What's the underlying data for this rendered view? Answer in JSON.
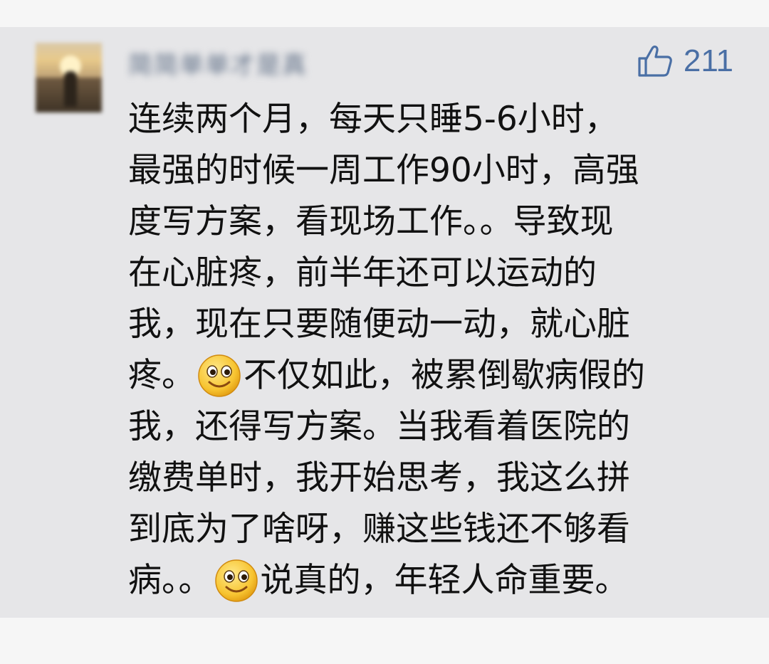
{
  "comment": {
    "username": "简简单单才是真",
    "like_count": "211",
    "lines": [
      {
        "before": "连续两个月，每天只睡5-6小时，",
        "emoji": false,
        "after": ""
      },
      {
        "before": "最强的时候一周工作90小时，高强",
        "emoji": false,
        "after": ""
      },
      {
        "before": "度写方案，看现场工作。。导致现",
        "emoji": false,
        "after": ""
      },
      {
        "before": "在心脏疼，前半年还可以运动的",
        "emoji": false,
        "after": ""
      },
      {
        "before": "我，现在只要随便动一动，就心脏",
        "emoji": false,
        "after": ""
      },
      {
        "before": "疼。",
        "emoji": true,
        "after": "不仅如此，被累倒歇病假的"
      },
      {
        "before": "我，还得写方案。当我看着医院的",
        "emoji": false,
        "after": ""
      },
      {
        "before": "缴费单时，我开始思考，我这么拼",
        "emoji": false,
        "after": ""
      },
      {
        "before": "到底为了啥呀，赚这些钱还不够看",
        "emoji": false,
        "after": ""
      },
      {
        "before": "病。。",
        "emoji": true,
        "after": "说真的，年轻人命重要。"
      }
    ]
  },
  "icons": {
    "like": "thumbs-up-icon",
    "avatar": "user-avatar",
    "emoji": "smiley-emoji-icon"
  },
  "colors": {
    "card_background": "#e6e6e8",
    "like_accent": "#4a6fa5",
    "text": "#111111",
    "username": "#5f6f86"
  }
}
